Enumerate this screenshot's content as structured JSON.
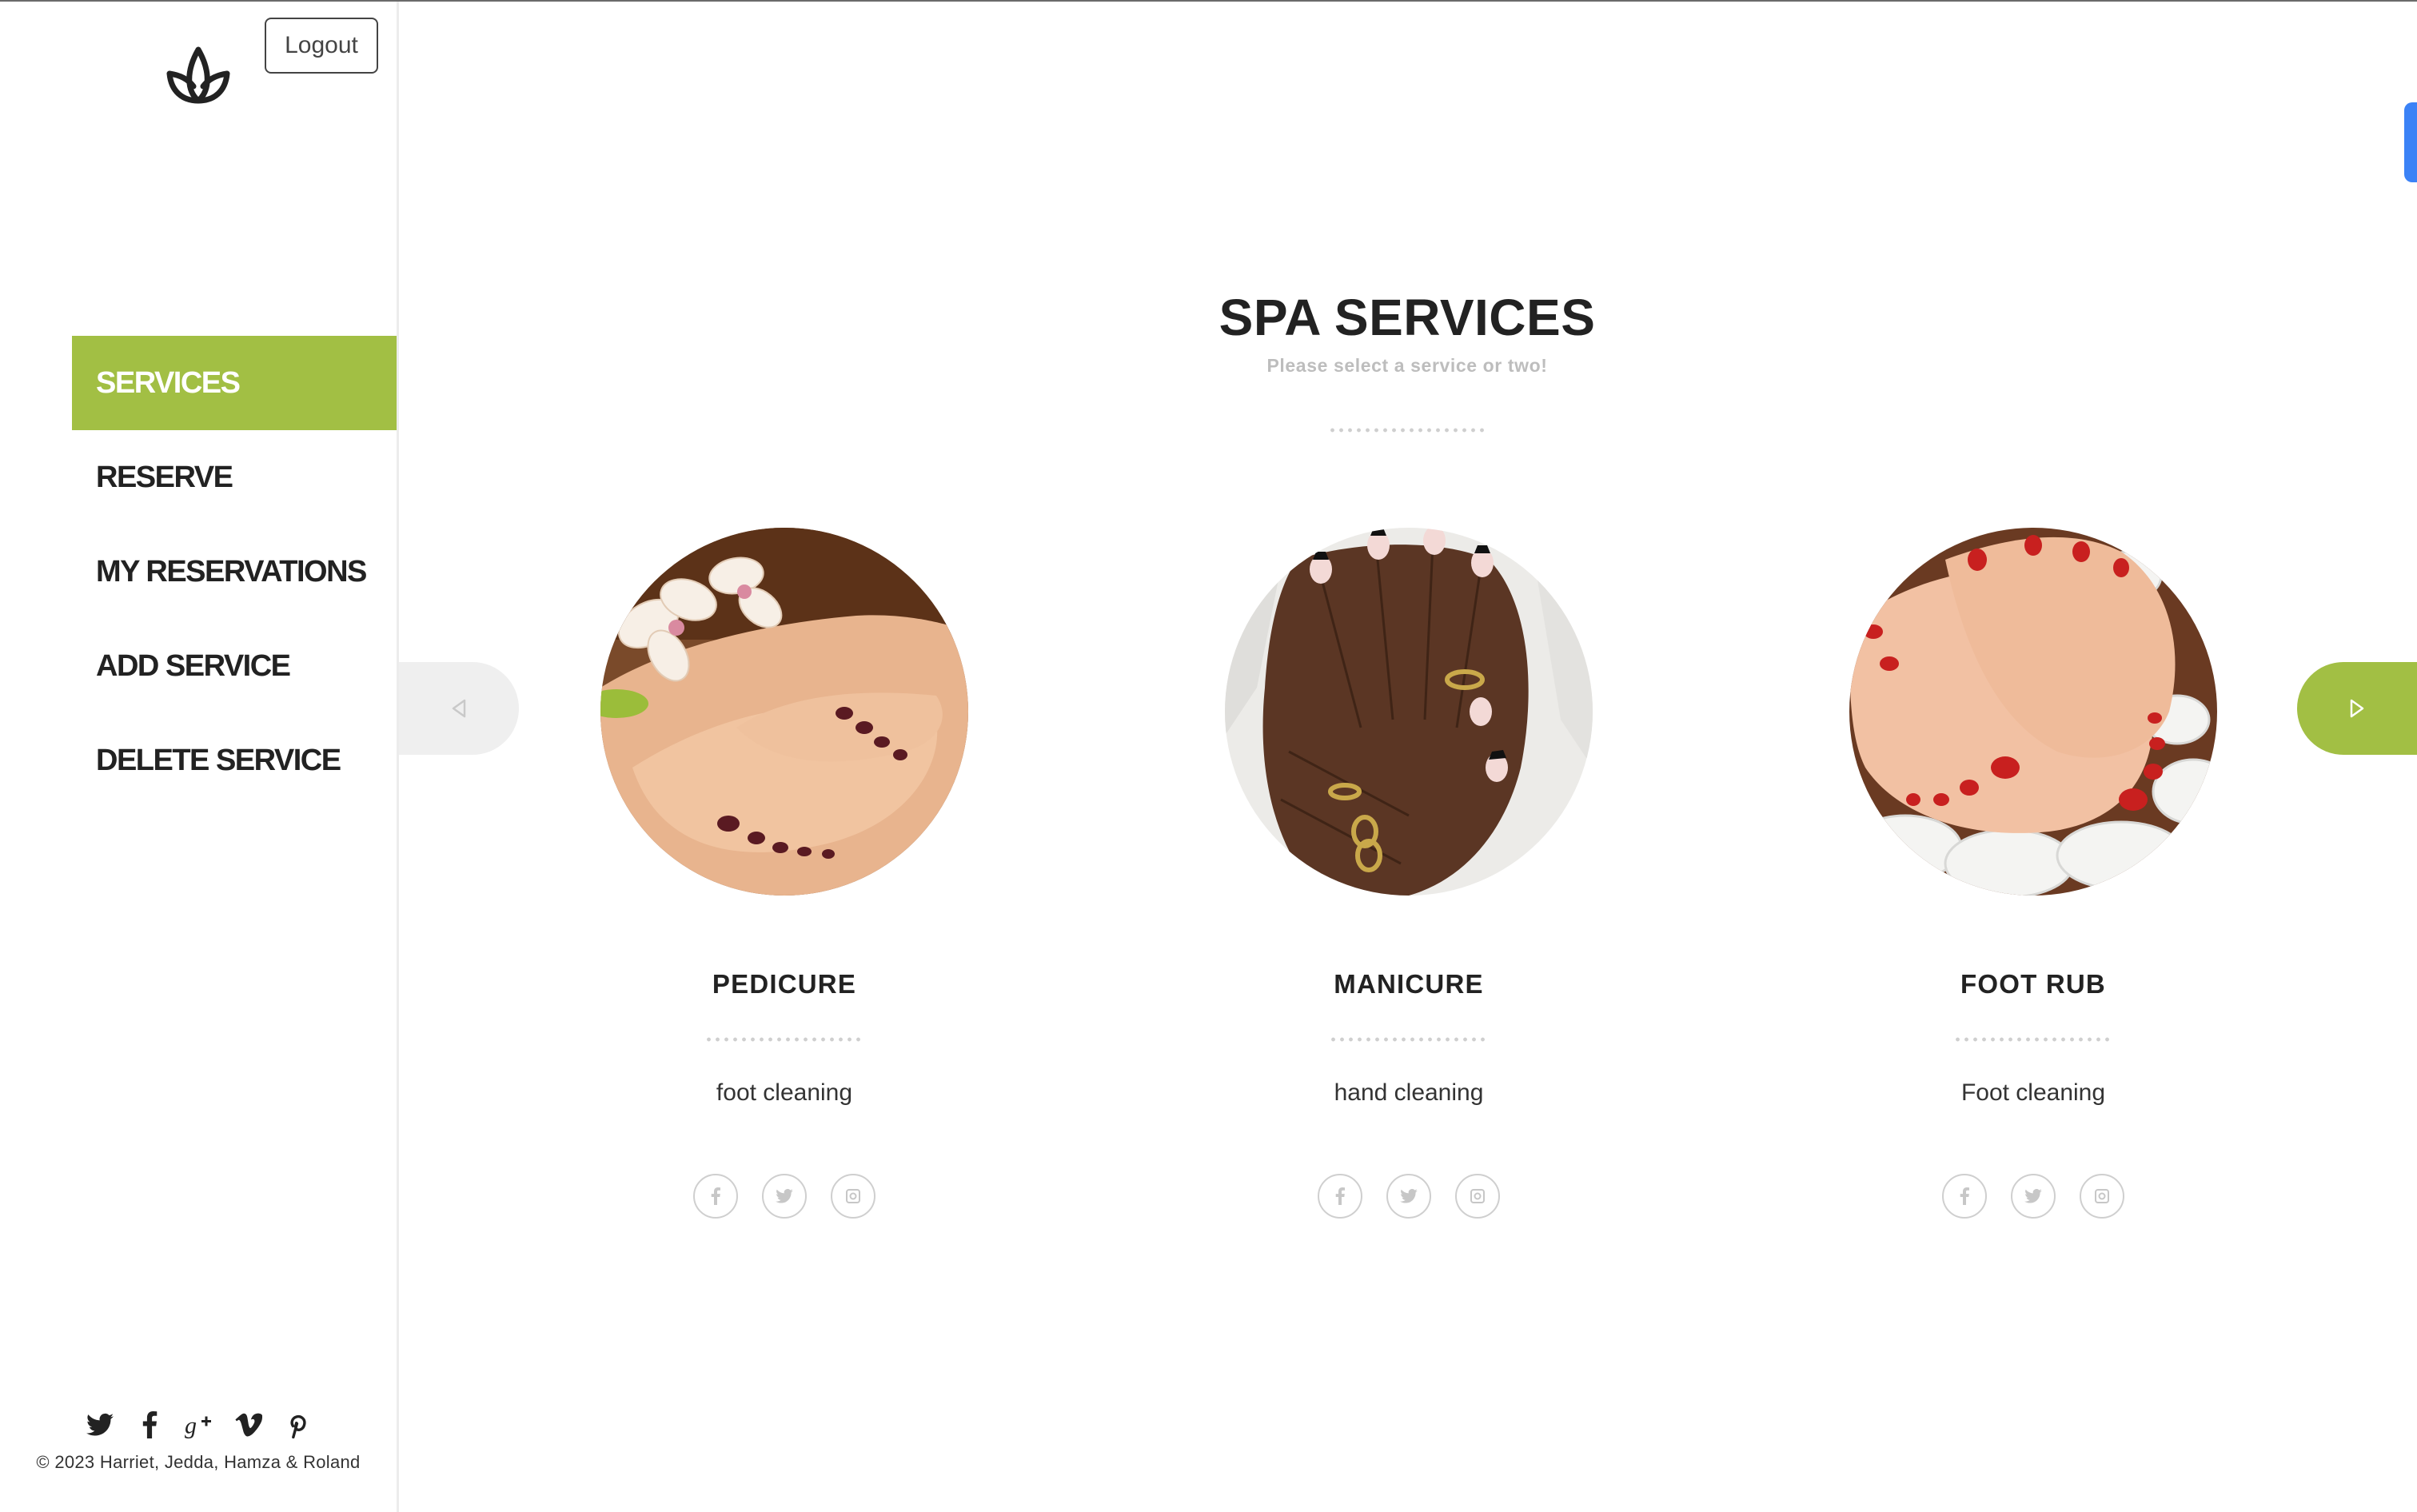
{
  "sidebar": {
    "logout_label": "Logout",
    "nav": [
      {
        "label": "SERVICES",
        "active": true
      },
      {
        "label": "RESERVE",
        "active": false
      },
      {
        "label": "MY RESERVATIONS",
        "active": false
      },
      {
        "label": "ADD SERVICE",
        "active": false
      },
      {
        "label": "DELETE SERVICE",
        "active": false
      }
    ],
    "social_icons": [
      "twitter-icon",
      "facebook-icon",
      "google-plus-icon",
      "vimeo-icon",
      "pinterest-icon"
    ],
    "copyright": "© 2023 Harriet, Jedda, Hamza & Roland"
  },
  "main": {
    "title": "SPA SERVICES",
    "subtitle": "Please select a service or two!",
    "services": [
      {
        "name": "PEDICURE",
        "description": "foot cleaning"
      },
      {
        "name": "MANICURE",
        "description": "hand cleaning"
      },
      {
        "name": "FOOT RUB",
        "description": "Foot cleaning"
      }
    ],
    "card_social_icons": [
      "facebook-icon",
      "twitter-icon",
      "instagram-icon"
    ]
  },
  "colors": {
    "accent": "#a2bf44",
    "text": "#222222",
    "muted": "#bdbdbd",
    "edge_tab": "#3b82f6"
  }
}
